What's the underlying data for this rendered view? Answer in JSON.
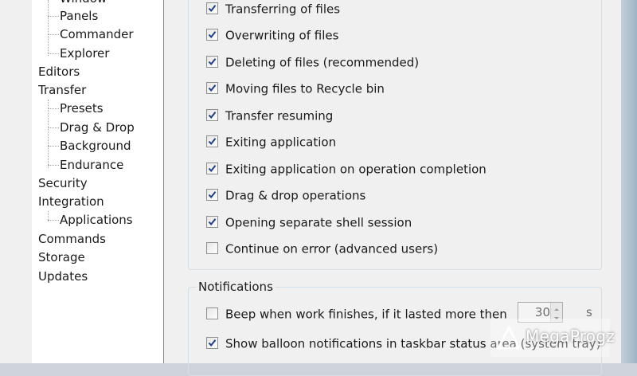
{
  "tree": {
    "items": [
      {
        "label": "Window",
        "child": true
      },
      {
        "label": "Panels",
        "child": true
      },
      {
        "label": "Commander",
        "child": true
      },
      {
        "label": "Explorer",
        "child": true
      },
      {
        "label": "Editors",
        "child": false
      },
      {
        "label": "Transfer",
        "child": false
      },
      {
        "label": "Presets",
        "child": true
      },
      {
        "label": "Drag & Drop",
        "child": true
      },
      {
        "label": "Background",
        "child": true
      },
      {
        "label": "Endurance",
        "child": true
      },
      {
        "label": "Security",
        "child": false
      },
      {
        "label": "Integration",
        "child": false
      },
      {
        "label": "Applications",
        "child": true
      },
      {
        "label": "Commands",
        "child": false
      },
      {
        "label": "Storage",
        "child": false
      },
      {
        "label": "Updates",
        "child": false
      }
    ]
  },
  "confirmations": {
    "items": [
      {
        "label": "Transferring of files",
        "checked": true
      },
      {
        "label": "Overwriting of files",
        "checked": true
      },
      {
        "label": "Deleting of files (recommended)",
        "checked": true
      },
      {
        "label": "Moving files to Recycle bin",
        "checked": true
      },
      {
        "label": "Transfer resuming",
        "checked": true
      },
      {
        "label": "Exiting application",
        "checked": true
      },
      {
        "label": "Exiting application on operation completion",
        "checked": true
      },
      {
        "label": "Drag & drop operations",
        "checked": true
      },
      {
        "label": "Opening separate shell session",
        "checked": true
      },
      {
        "label": "Continue on error (advanced users)",
        "checked": false
      }
    ]
  },
  "notifications": {
    "title": "Notifications",
    "beep": {
      "label": "Beep when work finishes, if it lasted more then",
      "checked": false
    },
    "beep_seconds": "30",
    "beep_unit": "s",
    "balloon": {
      "label": "Show balloon notifications in taskbar status area (system tray)",
      "checked": true
    }
  },
  "watermark": {
    "text": "MegaProgz"
  },
  "colors": {
    "check": "#1e3c84",
    "tree_line": "#a0a0a0"
  }
}
